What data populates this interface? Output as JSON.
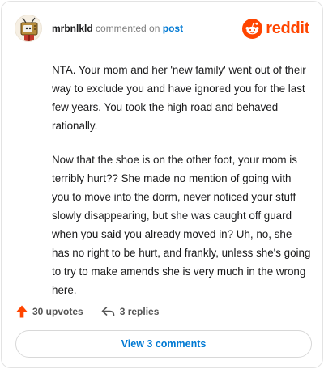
{
  "header": {
    "username": "mrbnlkld",
    "action_text": "commented on",
    "target_text": "post",
    "brand_name": "reddit",
    "brand_color": "#ff4500",
    "avatar_icon": "tv-head-avatar"
  },
  "comment": {
    "paragraphs": [
      "NTA. Your mom and her 'new family' went out of their way to exclude you and have ignored you for the last few years. You took the high road and behaved rationally.",
      "Now that the shoe is on the other foot, your mom is terribly hurt?? She made no mention of going with you to move into the dorm, never noticed your stuff slowly disappearing, but she was caught off guard when you said you already moved in? Uh, no, she has no right to be hurt, and frankly, unless she's going to try to make amends she is very much in the wrong here."
    ]
  },
  "actions": {
    "upvotes_label": "30 upvotes",
    "replies_label": "3 replies",
    "upvote_icon": "upvote-arrow-icon",
    "reply_icon": "reply-arrow-icon",
    "upvote_color": "#ff4500"
  },
  "footer": {
    "view_comments_label": "View 3 comments",
    "link_color": "#0079d3"
  }
}
